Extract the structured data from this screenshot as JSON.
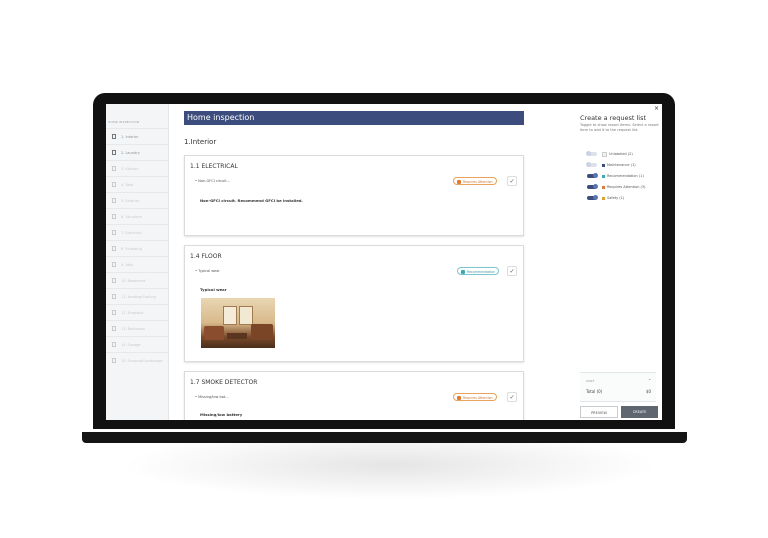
{
  "sidebar": {
    "title": "HOME INSPECTION",
    "items": [
      {
        "label": "1. Interior",
        "active": true
      },
      {
        "label": "2. Laundry",
        "active": true
      },
      {
        "label": "3. Kitchen",
        "active": false
      },
      {
        "label": "4. Roof",
        "active": false
      },
      {
        "label": "5. Exterior",
        "active": false
      },
      {
        "label": "6. Structure",
        "active": false
      },
      {
        "label": "7. Electrical",
        "active": false
      },
      {
        "label": "8. Plumbing",
        "active": false
      },
      {
        "label": "9. Attic",
        "active": false
      },
      {
        "label": "10. Basement",
        "active": false
      },
      {
        "label": "11. Heating/Cooling",
        "active": false
      },
      {
        "label": "12. Fireplace",
        "active": false
      },
      {
        "label": "13. Bathroom",
        "active": false
      },
      {
        "label": "14. Garage",
        "active": false
      },
      {
        "label": "15. Grounds/Landscape",
        "active": false
      }
    ]
  },
  "main": {
    "header": "Home inspection",
    "section": "1.Interior",
    "cards": [
      {
        "title": "1.1 ELECTRICAL",
        "sub": "• Non-GFCI circuit...",
        "badge": "Requires Attention",
        "body": "Non-GFCI circuit. Recommend GFCI be installed."
      },
      {
        "title": "1.4 FLOOR",
        "sub": "• Typical wear",
        "badge": "Recommendation",
        "body": "Typical wear"
      },
      {
        "title": "1.7 SMOKE DETECTOR",
        "sub": "• Missing/low bat...",
        "badge": "Requires Attention",
        "body": "Missing/low battery"
      }
    ],
    "check_icon": "✓"
  },
  "request_panel": {
    "close": "×",
    "title": "Create a request list",
    "description": "Toggle to show report items. Select a report item to add it to the request list.",
    "toggles": [
      {
        "label": "Unlabeled (2)",
        "on": false,
        "color": "#f0f2f4"
      },
      {
        "label": "Maintenance (1)",
        "on": false,
        "color": "#3c4c7c"
      },
      {
        "label": "Recommendation (1)",
        "on": true,
        "color": "#3aaab3"
      },
      {
        "label": "Requires Attention (3)",
        "on": true,
        "color": "#e07a3a"
      },
      {
        "label": "Safety (1)",
        "on": true,
        "color": "#d9a13a"
      }
    ],
    "cost_label": "COST",
    "chevron": "⌄",
    "total_label": "Total (0)",
    "total_value": "$0",
    "preview_label": "PREVIEW",
    "create_label": "CREATE"
  }
}
